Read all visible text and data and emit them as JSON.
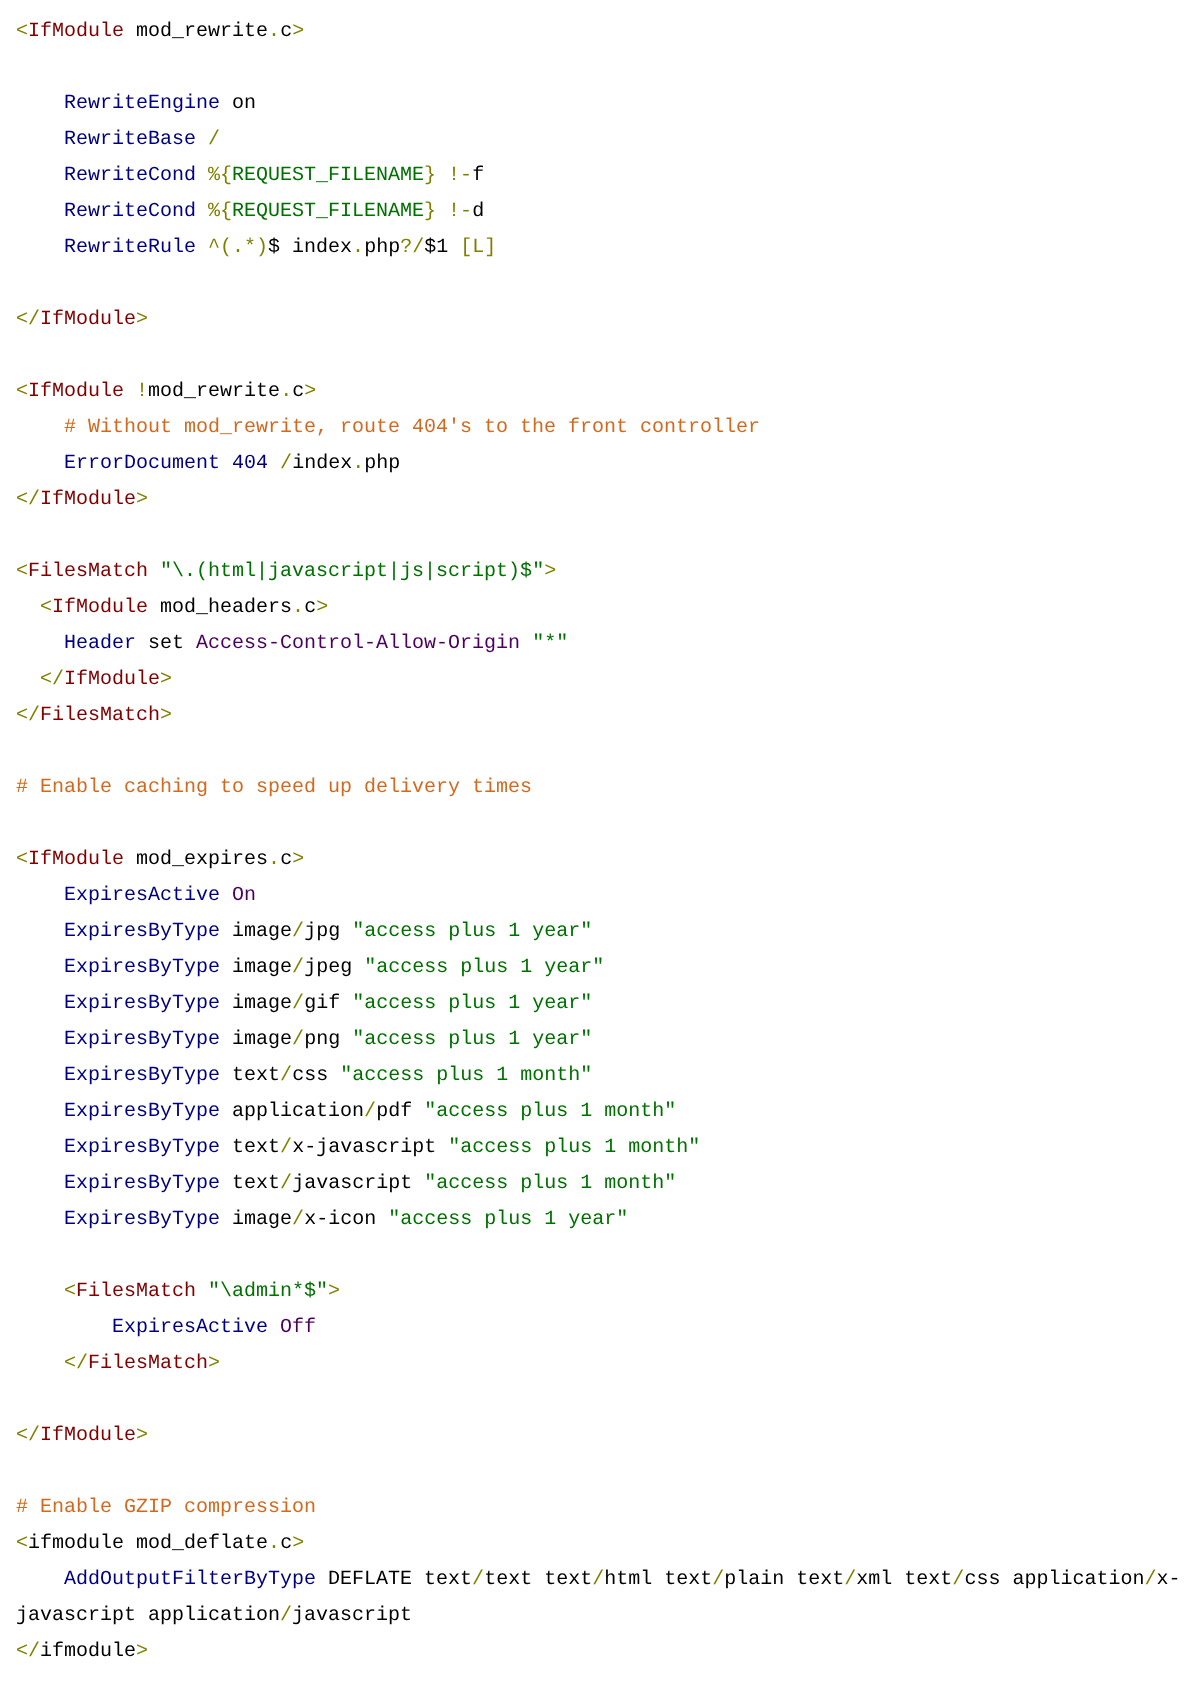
{
  "code_lines": [
    {
      "kind": "code",
      "tokens": [
        {
          "kind": "punct",
          "text": "<"
        },
        {
          "kind": "tag",
          "text": "IfModule"
        },
        {
          "kind": "plain",
          "text": " mod_rewrite"
        },
        {
          "kind": "punct",
          "text": "."
        },
        {
          "kind": "plain",
          "text": "c"
        },
        {
          "kind": "punct",
          "text": ">"
        }
      ]
    },
    {
      "kind": "blank"
    },
    {
      "kind": "code",
      "tokens": [
        {
          "kind": "directive",
          "text": "    RewriteEngine"
        },
        {
          "kind": "plain",
          "text": " on"
        }
      ]
    },
    {
      "kind": "code",
      "tokens": [
        {
          "kind": "directive",
          "text": "    RewriteBase"
        },
        {
          "kind": "punct",
          "text": " /"
        }
      ]
    },
    {
      "kind": "code",
      "tokens": [
        {
          "kind": "directive",
          "text": "    RewriteCond"
        },
        {
          "kind": "punct",
          "text": " %{"
        },
        {
          "kind": "string",
          "text": "REQUEST_FILENAME"
        },
        {
          "kind": "punct",
          "text": "} !-"
        },
        {
          "kind": "plain",
          "text": "f"
        }
      ]
    },
    {
      "kind": "code",
      "tokens": [
        {
          "kind": "directive",
          "text": "    RewriteCond"
        },
        {
          "kind": "punct",
          "text": " %{"
        },
        {
          "kind": "string",
          "text": "REQUEST_FILENAME"
        },
        {
          "kind": "punct",
          "text": "} !-"
        },
        {
          "kind": "plain",
          "text": "d"
        }
      ]
    },
    {
      "kind": "code",
      "tokens": [
        {
          "kind": "directive",
          "text": "    RewriteRule"
        },
        {
          "kind": "punct",
          "text": " ^(.*)"
        },
        {
          "kind": "plain",
          "text": "$ index"
        },
        {
          "kind": "punct",
          "text": "."
        },
        {
          "kind": "plain",
          "text": "php"
        },
        {
          "kind": "punct",
          "text": "?/"
        },
        {
          "kind": "plain",
          "text": "$1 "
        },
        {
          "kind": "punct",
          "text": "[L]"
        }
      ]
    },
    {
      "kind": "blank"
    },
    {
      "kind": "code",
      "tokens": [
        {
          "kind": "punct",
          "text": "</"
        },
        {
          "kind": "tag",
          "text": "IfModule"
        },
        {
          "kind": "punct",
          "text": ">"
        }
      ]
    },
    {
      "kind": "blank"
    },
    {
      "kind": "code",
      "tokens": [
        {
          "kind": "punct",
          "text": "<"
        },
        {
          "kind": "tag",
          "text": "IfModule"
        },
        {
          "kind": "punct",
          "text": " !"
        },
        {
          "kind": "plain",
          "text": "mod_rewrite"
        },
        {
          "kind": "punct",
          "text": "."
        },
        {
          "kind": "plain",
          "text": "c"
        },
        {
          "kind": "punct",
          "text": ">"
        }
      ]
    },
    {
      "kind": "code",
      "tokens": [
        {
          "kind": "comment",
          "text": "    # Without mod_rewrite, route 404's to the front controller"
        }
      ]
    },
    {
      "kind": "code",
      "tokens": [
        {
          "kind": "directive",
          "text": "    ErrorDocument"
        },
        {
          "kind": "number",
          "text": " 404"
        },
        {
          "kind": "punct",
          "text": " /"
        },
        {
          "kind": "plain",
          "text": "index"
        },
        {
          "kind": "punct",
          "text": "."
        },
        {
          "kind": "plain",
          "text": "php"
        }
      ]
    },
    {
      "kind": "code",
      "tokens": [
        {
          "kind": "punct",
          "text": "</"
        },
        {
          "kind": "tag",
          "text": "IfModule"
        },
        {
          "kind": "punct",
          "text": ">"
        }
      ]
    },
    {
      "kind": "blank"
    },
    {
      "kind": "code",
      "tokens": [
        {
          "kind": "punct",
          "text": "<"
        },
        {
          "kind": "tag",
          "text": "FilesMatch"
        },
        {
          "kind": "string",
          "text": " \"\\.(html|javascript|js|script)$\""
        },
        {
          "kind": "punct",
          "text": ">"
        }
      ]
    },
    {
      "kind": "code",
      "tokens": [
        {
          "kind": "punct",
          "text": "  <"
        },
        {
          "kind": "tag",
          "text": "IfModule"
        },
        {
          "kind": "plain",
          "text": " mod_headers"
        },
        {
          "kind": "punct",
          "text": "."
        },
        {
          "kind": "plain",
          "text": "c"
        },
        {
          "kind": "punct",
          "text": ">"
        }
      ]
    },
    {
      "kind": "code",
      "tokens": [
        {
          "kind": "directive",
          "text": "    Header"
        },
        {
          "kind": "plain",
          "text": " set "
        },
        {
          "kind": "value",
          "text": "Access-Control-Allow-Origin"
        },
        {
          "kind": "string",
          "text": " \"*\""
        }
      ]
    },
    {
      "kind": "code",
      "tokens": [
        {
          "kind": "punct",
          "text": "  </"
        },
        {
          "kind": "tag",
          "text": "IfModule"
        },
        {
          "kind": "punct",
          "text": ">"
        }
      ]
    },
    {
      "kind": "code",
      "tokens": [
        {
          "kind": "punct",
          "text": "</"
        },
        {
          "kind": "tag",
          "text": "FilesMatch"
        },
        {
          "kind": "punct",
          "text": ">"
        }
      ]
    },
    {
      "kind": "blank"
    },
    {
      "kind": "code",
      "tokens": [
        {
          "kind": "comment",
          "text": "# Enable caching to speed up delivery times"
        }
      ]
    },
    {
      "kind": "blank"
    },
    {
      "kind": "code",
      "tokens": [
        {
          "kind": "punct",
          "text": "<"
        },
        {
          "kind": "tag",
          "text": "IfModule"
        },
        {
          "kind": "plain",
          "text": " mod_expires"
        },
        {
          "kind": "punct",
          "text": "."
        },
        {
          "kind": "plain",
          "text": "c"
        },
        {
          "kind": "punct",
          "text": ">"
        }
      ]
    },
    {
      "kind": "code",
      "tokens": [
        {
          "kind": "directive",
          "text": "    ExpiresActive"
        },
        {
          "kind": "value",
          "text": " On"
        }
      ]
    },
    {
      "kind": "code",
      "tokens": [
        {
          "kind": "directive",
          "text": "    ExpiresByType"
        },
        {
          "kind": "plain",
          "text": " image"
        },
        {
          "kind": "punct",
          "text": "/"
        },
        {
          "kind": "plain",
          "text": "jpg "
        },
        {
          "kind": "string",
          "text": "\"access plus 1 year\""
        }
      ]
    },
    {
      "kind": "code",
      "tokens": [
        {
          "kind": "directive",
          "text": "    ExpiresByType"
        },
        {
          "kind": "plain",
          "text": " image"
        },
        {
          "kind": "punct",
          "text": "/"
        },
        {
          "kind": "plain",
          "text": "jpeg "
        },
        {
          "kind": "string",
          "text": "\"access plus 1 year\""
        }
      ]
    },
    {
      "kind": "code",
      "tokens": [
        {
          "kind": "directive",
          "text": "    ExpiresByType"
        },
        {
          "kind": "plain",
          "text": " image"
        },
        {
          "kind": "punct",
          "text": "/"
        },
        {
          "kind": "plain",
          "text": "gif "
        },
        {
          "kind": "string",
          "text": "\"access plus 1 year\""
        }
      ]
    },
    {
      "kind": "code",
      "tokens": [
        {
          "kind": "directive",
          "text": "    ExpiresByType"
        },
        {
          "kind": "plain",
          "text": " image"
        },
        {
          "kind": "punct",
          "text": "/"
        },
        {
          "kind": "plain",
          "text": "png "
        },
        {
          "kind": "string",
          "text": "\"access plus 1 year\""
        }
      ]
    },
    {
      "kind": "code",
      "tokens": [
        {
          "kind": "directive",
          "text": "    ExpiresByType"
        },
        {
          "kind": "plain",
          "text": " text"
        },
        {
          "kind": "punct",
          "text": "/"
        },
        {
          "kind": "plain",
          "text": "css "
        },
        {
          "kind": "string",
          "text": "\"access plus 1 month\""
        }
      ]
    },
    {
      "kind": "code",
      "tokens": [
        {
          "kind": "directive",
          "text": "    ExpiresByType"
        },
        {
          "kind": "plain",
          "text": " application"
        },
        {
          "kind": "punct",
          "text": "/"
        },
        {
          "kind": "plain",
          "text": "pdf "
        },
        {
          "kind": "string",
          "text": "\"access plus 1 month\""
        }
      ]
    },
    {
      "kind": "code",
      "tokens": [
        {
          "kind": "directive",
          "text": "    ExpiresByType"
        },
        {
          "kind": "plain",
          "text": " text"
        },
        {
          "kind": "punct",
          "text": "/"
        },
        {
          "kind": "plain",
          "text": "x-javascript "
        },
        {
          "kind": "string",
          "text": "\"access plus 1 month\""
        }
      ]
    },
    {
      "kind": "code",
      "tokens": [
        {
          "kind": "directive",
          "text": "    ExpiresByType"
        },
        {
          "kind": "plain",
          "text": " text"
        },
        {
          "kind": "punct",
          "text": "/"
        },
        {
          "kind": "plain",
          "text": "javascript "
        },
        {
          "kind": "string",
          "text": "\"access plus 1 month\""
        }
      ]
    },
    {
      "kind": "code",
      "tokens": [
        {
          "kind": "directive",
          "text": "    ExpiresByType"
        },
        {
          "kind": "plain",
          "text": " image"
        },
        {
          "kind": "punct",
          "text": "/"
        },
        {
          "kind": "plain",
          "text": "x-icon "
        },
        {
          "kind": "string",
          "text": "\"access plus 1 year\""
        }
      ]
    },
    {
      "kind": "blank"
    },
    {
      "kind": "code",
      "tokens": [
        {
          "kind": "punct",
          "text": "    <"
        },
        {
          "kind": "tag",
          "text": "FilesMatch"
        },
        {
          "kind": "string",
          "text": " \"\\admin*$\""
        },
        {
          "kind": "punct",
          "text": ">"
        }
      ]
    },
    {
      "kind": "code",
      "tokens": [
        {
          "kind": "directive",
          "text": "        ExpiresActive"
        },
        {
          "kind": "value",
          "text": " Off"
        }
      ]
    },
    {
      "kind": "code",
      "tokens": [
        {
          "kind": "punct",
          "text": "    </"
        },
        {
          "kind": "tag",
          "text": "FilesMatch"
        },
        {
          "kind": "punct",
          "text": ">"
        }
      ]
    },
    {
      "kind": "blank"
    },
    {
      "kind": "code",
      "tokens": [
        {
          "kind": "punct",
          "text": "</"
        },
        {
          "kind": "tag",
          "text": "IfModule"
        },
        {
          "kind": "punct",
          "text": ">"
        }
      ]
    },
    {
      "kind": "blank"
    },
    {
      "kind": "code",
      "tokens": [
        {
          "kind": "comment",
          "text": "# Enable GZIP compression"
        }
      ]
    },
    {
      "kind": "code",
      "tokens": [
        {
          "kind": "punct",
          "text": "<"
        },
        {
          "kind": "plain",
          "text": "ifmodule mod_deflate"
        },
        {
          "kind": "punct",
          "text": "."
        },
        {
          "kind": "plain",
          "text": "c"
        },
        {
          "kind": "punct",
          "text": ">"
        }
      ]
    },
    {
      "kind": "code",
      "tokens": [
        {
          "kind": "directive",
          "text": "    AddOutputFilterByType"
        },
        {
          "kind": "plain",
          "text": " DEFLATE text"
        },
        {
          "kind": "punct",
          "text": "/"
        },
        {
          "kind": "plain",
          "text": "text text"
        },
        {
          "kind": "punct",
          "text": "/"
        },
        {
          "kind": "plain",
          "text": "html text"
        },
        {
          "kind": "punct",
          "text": "/"
        },
        {
          "kind": "plain",
          "text": "plain text"
        },
        {
          "kind": "punct",
          "text": "/"
        },
        {
          "kind": "plain",
          "text": "xml text"
        },
        {
          "kind": "punct",
          "text": "/"
        },
        {
          "kind": "plain",
          "text": "css application"
        },
        {
          "kind": "punct",
          "text": "/"
        },
        {
          "kind": "plain",
          "text": "x-"
        }
      ]
    },
    {
      "kind": "code",
      "tokens": [
        {
          "kind": "plain",
          "text": "javascript application"
        },
        {
          "kind": "punct",
          "text": "/"
        },
        {
          "kind": "plain",
          "text": "javascript"
        }
      ]
    },
    {
      "kind": "code",
      "tokens": [
        {
          "kind": "punct",
          "text": "</"
        },
        {
          "kind": "plain",
          "text": "ifmodule"
        },
        {
          "kind": "punct",
          "text": ">"
        }
      ]
    }
  ]
}
